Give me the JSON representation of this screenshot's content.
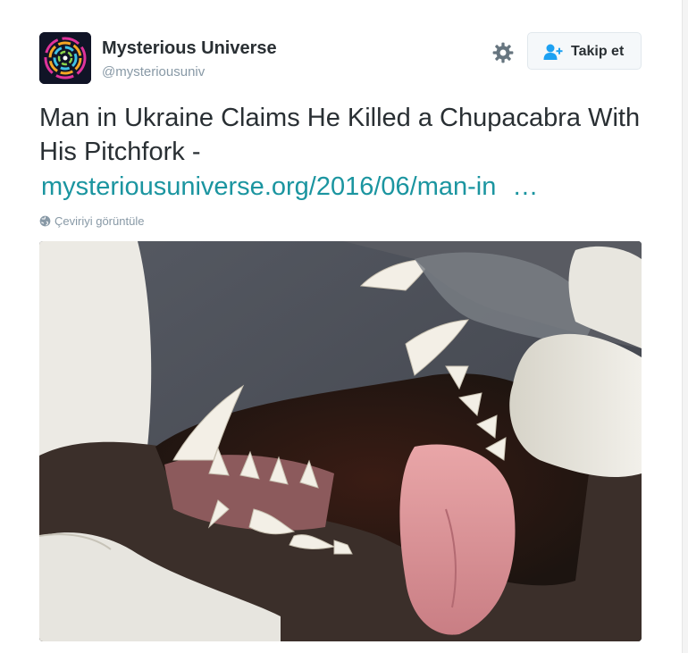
{
  "tweet": {
    "user": {
      "name": "Mysterious Universe",
      "handle": "@mysteriousuniv",
      "avatar_icon": "concentric-rings-logo"
    },
    "follow_button": {
      "label": "Takip et",
      "icon": "add-user-icon"
    },
    "settings_icon": "gear-icon",
    "text": "Man in Ukraine Claims He Killed a Chupacabra With His Pitchfork -",
    "link": {
      "text": "mysteriousuniverse.org/2016/06/man-in",
      "ellipsis": "…"
    },
    "translate_label": "Çeviriyi görüntüle",
    "translate_icon": "globe-icon",
    "media": {
      "kind": "photo",
      "subject": "gloved hands holding open an animal's jaw"
    }
  },
  "colors": {
    "text": "#292f33",
    "secondary": "#8899a6",
    "link": "#1b95a0",
    "button_bg": "#f5f8fa",
    "button_border": "#e1e8ed"
  }
}
